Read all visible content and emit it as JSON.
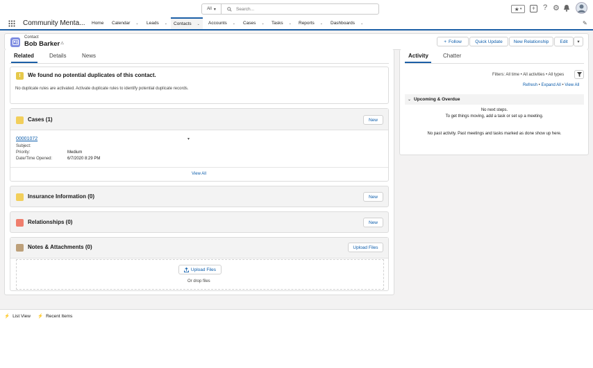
{
  "header": {
    "search_scope": "All",
    "search_placeholder": "Search..."
  },
  "nav": {
    "app_name": "Community Menta...",
    "tabs": [
      {
        "label": "Home",
        "has_menu": false
      },
      {
        "label": "Calendar",
        "has_menu": true
      },
      {
        "label": "Leads",
        "has_menu": true
      },
      {
        "label": "Contacts",
        "has_menu": true,
        "active": true
      },
      {
        "label": "Accounts",
        "has_menu": true
      },
      {
        "label": "Cases",
        "has_menu": true
      },
      {
        "label": "Tasks",
        "has_menu": true
      },
      {
        "label": "Reports",
        "has_menu": true
      },
      {
        "label": "Dashboards",
        "has_menu": true
      }
    ]
  },
  "record": {
    "object_label": "Contact",
    "name": "Bob Barker",
    "actions": {
      "follow": "Follow",
      "quick_update": "Quick Update",
      "new_relationship": "New Relationship",
      "edit": "Edit"
    }
  },
  "left_tabs": {
    "related": "Related",
    "details": "Details",
    "news": "News"
  },
  "duplicates": {
    "title": "We found no potential duplicates of this contact.",
    "body": "No duplicate rules are activated. Activate duplicate rules to identify potential duplicate records."
  },
  "cases": {
    "title": "Cases (1)",
    "new_label": "New",
    "record_link": "00001072",
    "fields": [
      {
        "label": "Subject:",
        "value": ""
      },
      {
        "label": "Priority:",
        "value": "Medium"
      },
      {
        "label": "Date/Time Opened:",
        "value": "6/7/2020 8:29 PM"
      }
    ],
    "view_all": "View All"
  },
  "insurance": {
    "title": "Insurance Information (0)",
    "new_label": "New"
  },
  "relationships": {
    "title": "Relationships (0)",
    "new_label": "New"
  },
  "notes": {
    "title": "Notes & Attachments (0)",
    "upload_label": "Upload Files",
    "drop_upload_label": "Upload Files",
    "drop_text": "Or drop files"
  },
  "activity": {
    "tab_activity": "Activity",
    "tab_chatter": "Chatter",
    "filters": "Filters: All time • All activities • All types",
    "refresh": "Refresh",
    "expand_all": "Expand All",
    "view_all": "View All",
    "upcoming_title": "Upcoming & Overdue",
    "no_next_steps": "No next steps.",
    "no_next_hint": "To get things moving, add a task or set up a meeting.",
    "no_past": "No past activity. Past meetings and tasks marked as done show up here."
  },
  "footer": {
    "list_view": "List View",
    "recent_items": "Recent Items"
  },
  "colors": {
    "brand": "#1b5fa6",
    "contact_icon": "#7f8de1",
    "cases_icon": "#f2cf5b",
    "insurance_icon": "#f2cf5b",
    "relationships_icon": "#ef7e6d",
    "notes_icon": "#bda07a",
    "dup_icon": "#e6c94b"
  }
}
